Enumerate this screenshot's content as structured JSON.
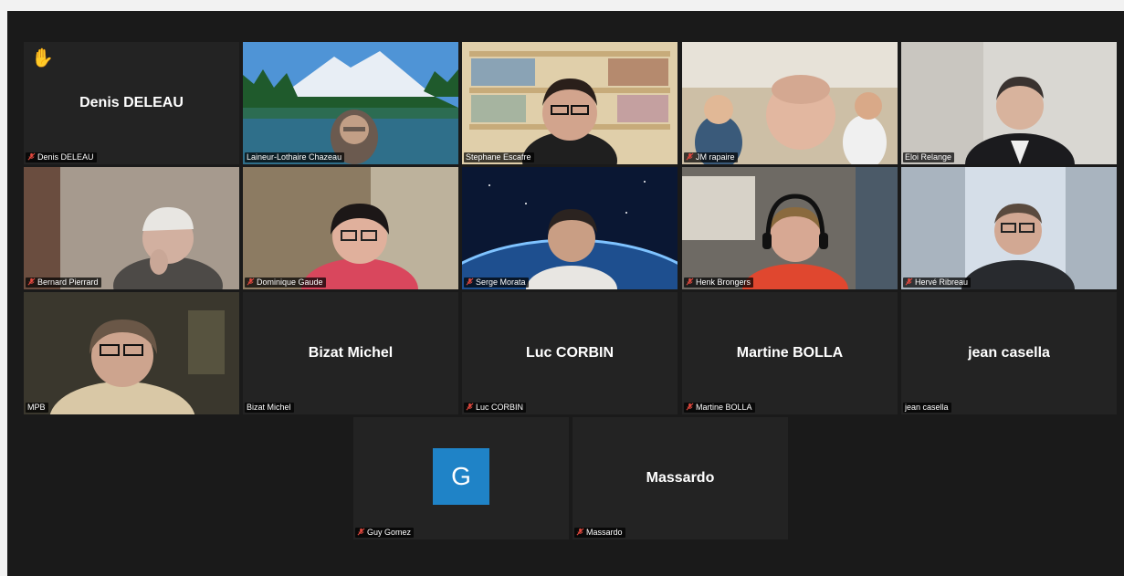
{
  "window": {
    "background": "#1a1a1a"
  },
  "participants": [
    {
      "name": "Denis DELEAU",
      "label": "Denis DELEAU",
      "muted": true,
      "video": false,
      "hand_raised": true
    },
    {
      "label": "Laineur-Lothaire Chazeau",
      "muted": false,
      "video": true
    },
    {
      "label": "Stephane Escafre",
      "muted": false,
      "video": true,
      "active_speaker": true
    },
    {
      "label": "JM rapaire",
      "muted": true,
      "video": true
    },
    {
      "label": "Eloi Relange",
      "muted": false,
      "video": true
    },
    {
      "label": "Bernard Pierrard",
      "muted": true,
      "video": true
    },
    {
      "label": "Dominique Gaude",
      "muted": true,
      "video": true
    },
    {
      "label": "Serge Morata",
      "muted": true,
      "video": true
    },
    {
      "label": "Henk Brongers",
      "muted": true,
      "video": true
    },
    {
      "label": "Hervé Ribreau",
      "muted": true,
      "video": true
    },
    {
      "label": "MPB",
      "muted": false,
      "video": true
    },
    {
      "name": "Bizat Michel",
      "label": "Bizat Michel",
      "muted": false,
      "video": false
    },
    {
      "name": "Luc CORBIN",
      "label": "Luc CORBIN",
      "muted": true,
      "video": false
    },
    {
      "name": "Martine BOLLA",
      "label": "Martine BOLLA",
      "muted": true,
      "video": false
    },
    {
      "name": "jean casella",
      "label": "jean casella",
      "muted": false,
      "video": false
    },
    {
      "avatar_letter": "G",
      "label": "Guy Gomez",
      "muted": true,
      "video": false,
      "avatar_color": "#1f83c7"
    },
    {
      "name": "Massardo",
      "label": "Massardo",
      "muted": true,
      "video": false
    }
  ],
  "colors": {
    "active_speaker_border": "#e9e14c",
    "muted_icon": "#e0483e",
    "tile_background": "#232323"
  }
}
